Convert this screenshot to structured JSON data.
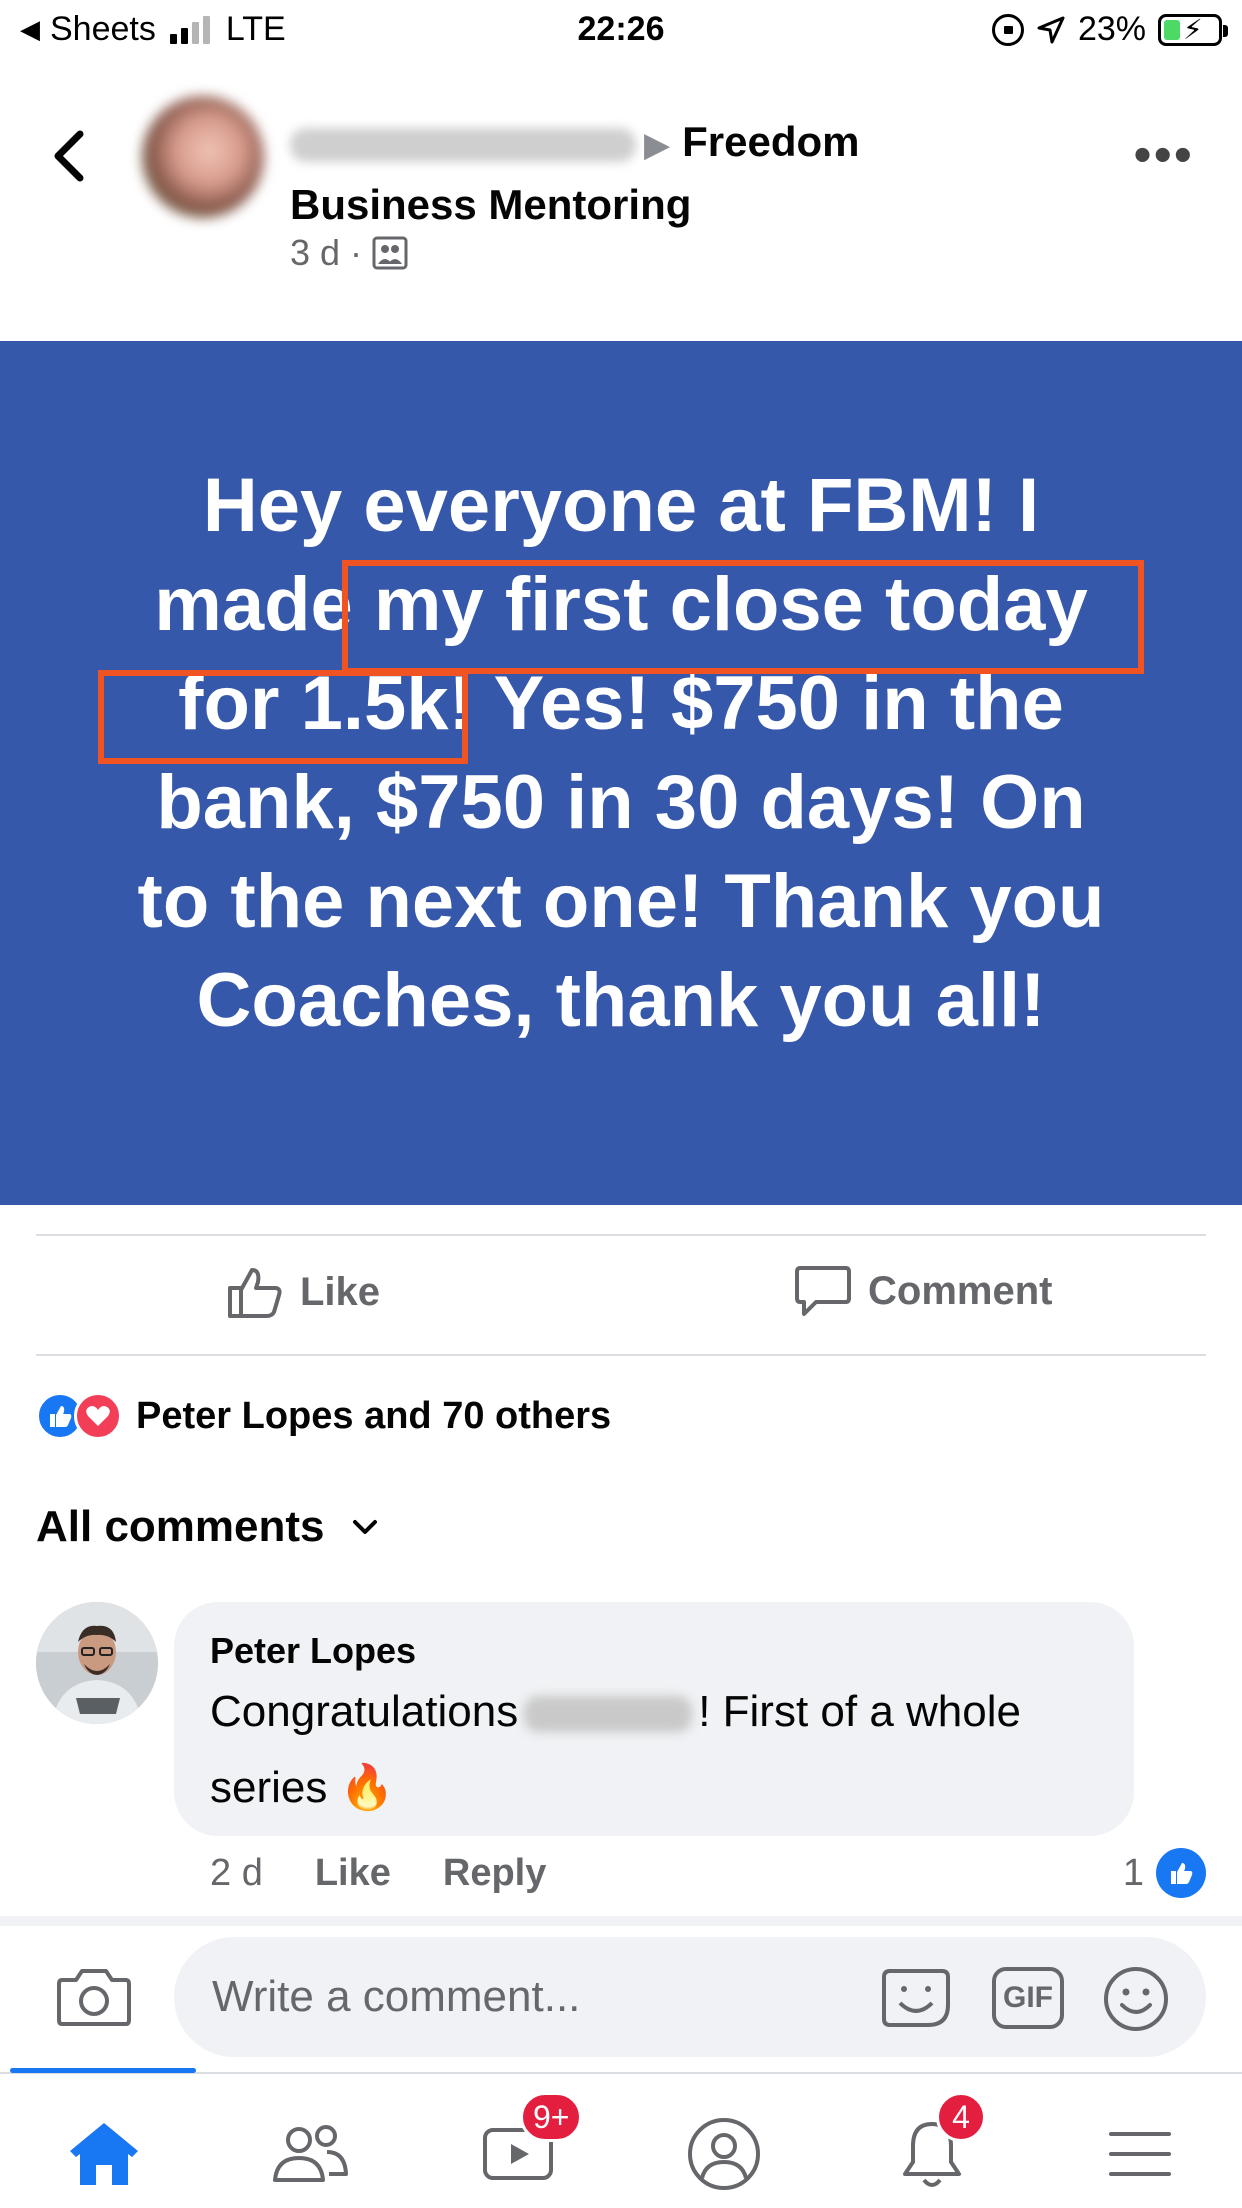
{
  "status_bar": {
    "back_app": "Sheets",
    "network": "LTE",
    "time": "22:26",
    "battery": "23%"
  },
  "post": {
    "group_line1": "Freedom",
    "group_line2": "Business Mentoring",
    "age": "3 d",
    "separator": "·",
    "text_lines": [
      "Hey everyone at FBM! I",
      "made my first close today",
      "for 1.5k! Yes! $750 in the",
      "bank, $750 in 30 days! On",
      "to the next one! Thank you",
      "Coaches, thank you all!"
    ],
    "background_color": "#3658ab",
    "highlight_color": "#ef5422"
  },
  "actions": {
    "like": "Like",
    "comment": "Comment"
  },
  "reactions": {
    "summary": "Peter Lopes and 70 others"
  },
  "comments": {
    "filter_label": "All comments",
    "items": [
      {
        "author": "Peter Lopes",
        "text_before": "Congratulations",
        "text_after": "! First of a whole",
        "text_line2": "series 🔥",
        "age": "2 d",
        "like": "Like",
        "reply": "Reply",
        "like_count": "1"
      }
    ]
  },
  "composer": {
    "placeholder": "Write a comment...",
    "gif": "GIF"
  },
  "nav": {
    "video_badge": "9+",
    "notifications_badge": "4",
    "accent": "#1877f2"
  }
}
